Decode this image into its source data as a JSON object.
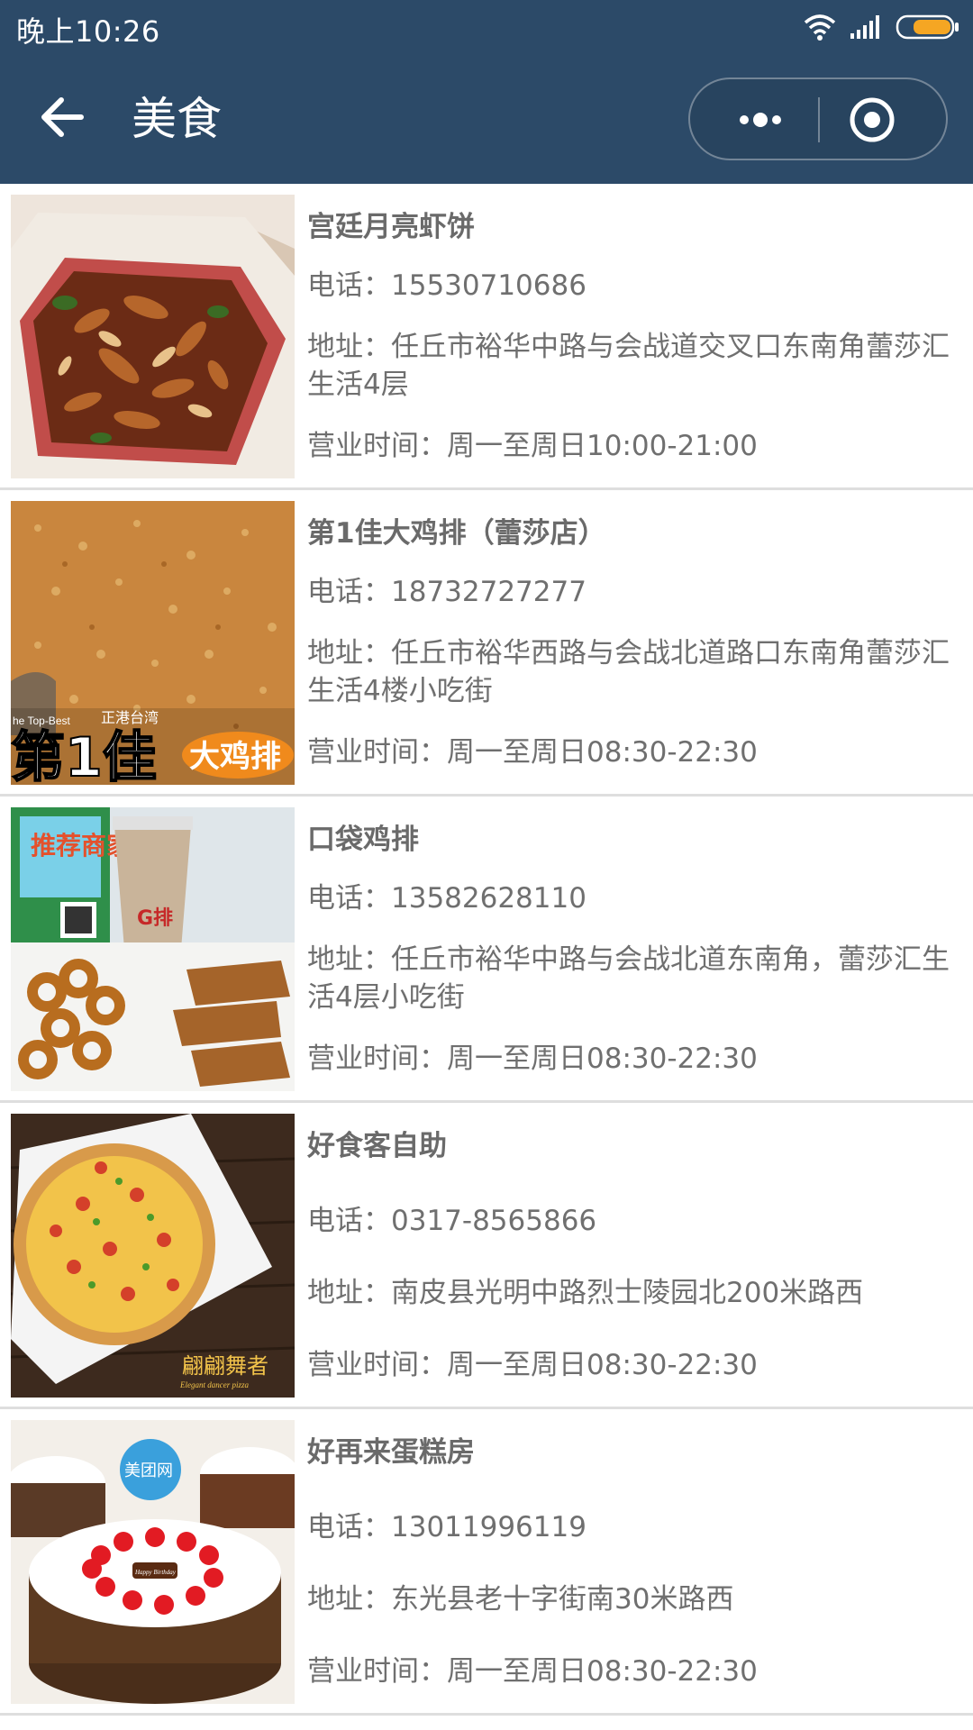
{
  "status_bar": {
    "time": "晚上10:26"
  },
  "nav": {
    "title": "美食"
  },
  "colors": {
    "header_bg": "#2c4a68",
    "text": "#707070",
    "divider": "#dedede"
  },
  "labels": {
    "phone": "电话：",
    "address": "地址：",
    "hours": "营业时间："
  },
  "shops": [
    {
      "name": "宫廷月亮虾饼",
      "phone": "15530710686",
      "address": "任丘市裕华中路与会战道交叉口东南角蕾莎汇生活4层",
      "hours": "周一至周日10:00-21:00",
      "image": "shrimp-cake-photo"
    },
    {
      "name": "第1佳大鸡排（蕾莎店）",
      "phone": "18732727277",
      "address": "任丘市裕华西路与会战北道路口东南角蕾莎汇生活4楼小吃街",
      "hours": "周一至周日08:30-22:30",
      "image": "chicken-steak-photo",
      "image_text": {
        "line1": "he Top-Best",
        "line2": "正港台湾",
        "brand": "第1佳",
        "badge": "大鸡排"
      }
    },
    {
      "name": "口袋鸡排",
      "phone": "13582628110",
      "address": "任丘市裕华中路与会战北道东南角，蕾莎汇生活4层小吃街",
      "hours": "周一至周日08:30-22:30",
      "image": "fried-chicken-photo",
      "image_text": {
        "sign": "推荐商家",
        "cup": "G排"
      }
    },
    {
      "name": "好食客自助",
      "phone": "0317-8565866",
      "address": "南皮县光明中路烈士陵园北200米路西",
      "hours": "周一至周日08:30-22:30",
      "image": "pizza-photo",
      "image_text": {
        "brand": "翩翩舞者",
        "sub": "Elegant dancer pizza"
      }
    },
    {
      "name": "好再来蛋糕房",
      "phone": "13011996119",
      "address": "东光县老十字街南30米路西",
      "hours": "周一至周日08:30-22:30",
      "image": "cake-photo",
      "image_text": {
        "badge": "美团网",
        "plaque": "Happy Birthday"
      }
    }
  ]
}
